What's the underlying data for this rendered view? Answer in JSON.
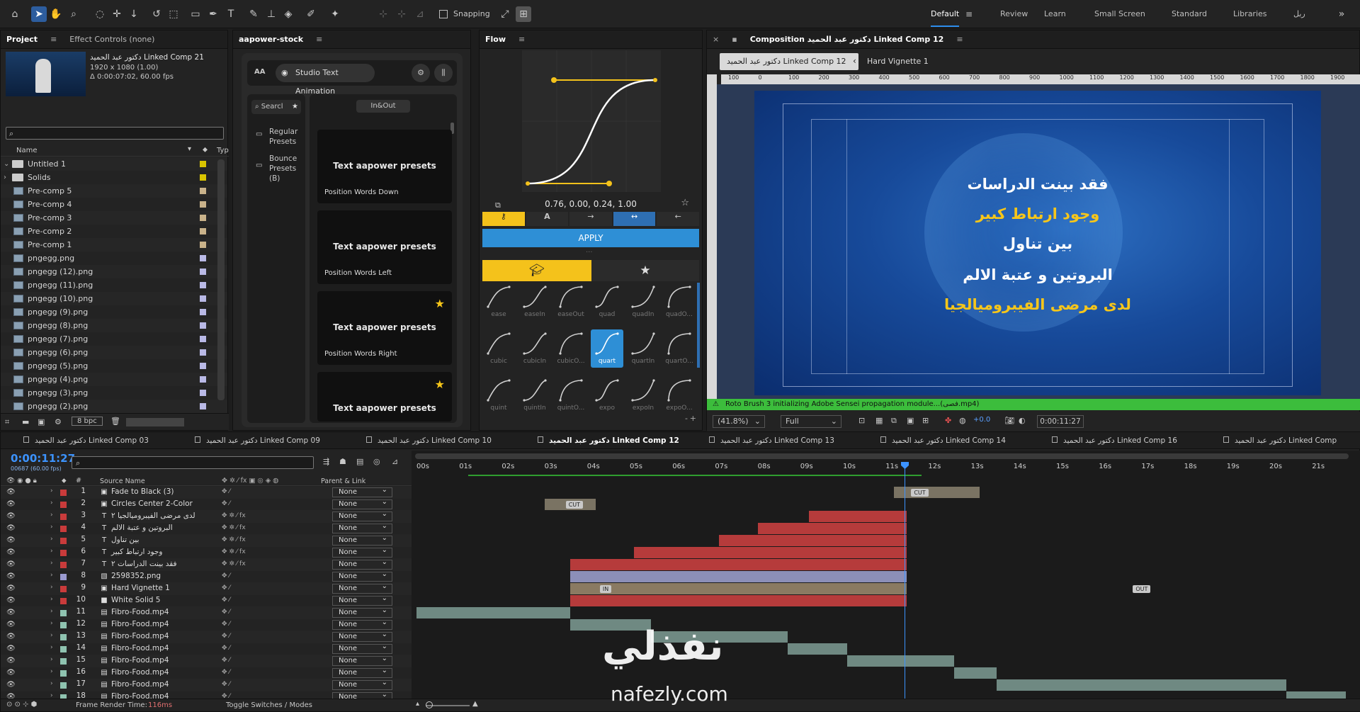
{
  "toolbar": {
    "snapping_label": "Snapping",
    "workspaces": [
      "Default",
      "Review",
      "Learn",
      "Small Screen",
      "Standard",
      "Libraries",
      "ربل"
    ],
    "active_workspace": "Default"
  },
  "project": {
    "tabs": [
      "Project",
      "Effect Controls (none)"
    ],
    "item_name": "دكتور عبد الحميد  Linked Comp 21",
    "item_res": "1920 x 1080 (1.00)",
    "item_dur": "Δ 0:00:07:02, 60.00 fps",
    "search_placeholder": "",
    "col_name": "Name",
    "col_type": "Typ",
    "items": [
      "Untitled 1",
      "Solids",
      "Pre-comp 5",
      "Pre-comp 4",
      "Pre-comp 3",
      "Pre-comp 2",
      "Pre-comp 1",
      "pngegg.png",
      "pngegg (12).png",
      "pngegg (11).png",
      "pngegg (10).png",
      "pngegg (9).png",
      "pngegg (8).png",
      "pngegg (7).png",
      "pngegg (6).png",
      "pngegg (5).png",
      "pngegg (4).png",
      "pngegg (3).png",
      "pngegg (2).png"
    ],
    "bpc": "8 bpc"
  },
  "aapower": {
    "panel_title": "aapower-stock",
    "aa": "AA",
    "studio_label": "Studio Text Animation",
    "search_label": "Searcl",
    "inout_label": "In&Out",
    "categories": [
      "Regular Presets",
      "Bounce Presets (B)"
    ],
    "presets": [
      {
        "title": "Text aapower presets",
        "sub": "Position Words Down",
        "star": false
      },
      {
        "title": "Text aapower presets",
        "sub": "Position Words Left",
        "star": false
      },
      {
        "title": "Text aapower presets",
        "sub": "Position Words Right",
        "star": true
      },
      {
        "title": "Text aapower presets",
        "sub": "",
        "star": true
      }
    ]
  },
  "flow": {
    "panel_title": "Flow",
    "bezier_values": "0.76, 0.00, 0.24, 1.00",
    "apply_label": "APPLY",
    "ease_names": [
      "ease",
      "easeIn",
      "easeOut",
      "quad",
      "quadIn",
      "quadO...",
      "cubic",
      "cubicIn",
      "cubicO...",
      "quart",
      "quartIn",
      "quartO...",
      "quint",
      "quintIn",
      "quintO...",
      "expo",
      "expoIn",
      "expoO..."
    ],
    "selected_ease": "quart",
    "accent": "#f4c21b",
    "blue": "#2e8fd6"
  },
  "composition": {
    "panel_title": "Composition دكتور عبد الحميد  Linked Comp 12",
    "active_tab": "دكتور عبد الحميد  Linked Comp 12",
    "other_tab": "Hard Vignette 1",
    "ruler_labels": [
      "100",
      "0",
      "100",
      "200",
      "300",
      "400",
      "500",
      "600",
      "700",
      "800",
      "900",
      "1000",
      "1100",
      "1200",
      "1300",
      "1400",
      "1500",
      "1600",
      "1700",
      "1800",
      "1900",
      "200"
    ],
    "captions": [
      {
        "text": "فقد بينت الدراسات",
        "color": "#ffffff"
      },
      {
        "text": "وجود ارتباط كبير",
        "color": "#f6c61a"
      },
      {
        "text": "بين تناول",
        "color": "#ffffff"
      },
      {
        "text": "البروتين و عتبة الالم",
        "color": "#ffffff"
      },
      {
        "text": "لدى مرضى الفيبروميالجيا",
        "color": "#f6c61a"
      }
    ],
    "warning": "Roto Brush 3 initializing Adobe Sensei propagation module...(فصى.mp4)",
    "zoom": "(41.8%)",
    "resolution": "Full",
    "exposure": "+0.0",
    "timecode": "0:00:11:27"
  },
  "timeline": {
    "tabs": [
      "دكتور عبد الحميد  Linked Comp 03",
      "دكتور عبد الحميد  Linked Comp 09",
      "دكتور عبد الحميد  Linked Comp 10",
      "دكتور عبد الحميد  Linked Comp 12",
      "دكتور عبد الحميد  Linked Comp 13",
      "دكتور عبد الحميد  Linked Comp 14",
      "دكتور عبد الحميد  Linked Comp 16",
      "دكتور عبد الحميد  Linked Comp"
    ],
    "active_tab": "دكتور عبد الحميد  Linked Comp 12",
    "current_time": "0:00:11:27",
    "frame_info": "00687 (60.00 fps)",
    "col_source": "Source Name",
    "col_parent": "Parent & Link",
    "ruler": [
      "00s",
      "01s",
      "02s",
      "03s",
      "04s",
      "05s",
      "06s",
      "07s",
      "08s",
      "09s",
      "10s",
      "11s",
      "12s",
      "13s",
      "14s",
      "15s",
      "16s",
      "17s",
      "18s",
      "19s",
      "20s",
      "21s"
    ],
    "parent_value": "None",
    "layers": [
      {
        "n": "1",
        "name": "Fade to Black (3)",
        "type": "comp",
        "color": "#c93b3b"
      },
      {
        "n": "2",
        "name": "Circles Center 2-Color",
        "type": "comp",
        "color": "#c93b3b"
      },
      {
        "n": "3",
        "name": "لدى مرضى الفيبروميالجيا ٢",
        "type": "text",
        "color": "#c93b3b"
      },
      {
        "n": "4",
        "name": "البروتين و عتبة الالم",
        "type": "text",
        "color": "#c93b3b"
      },
      {
        "n": "5",
        "name": "بين تناول",
        "type": "text",
        "color": "#c93b3b"
      },
      {
        "n": "6",
        "name": "وجود ارتباط كبير",
        "type": "text",
        "color": "#c93b3b"
      },
      {
        "n": "7",
        "name": "فقد بينت الدراسات ٢",
        "type": "text",
        "color": "#c93b3b"
      },
      {
        "n": "8",
        "name": "2598352.png",
        "type": "image",
        "color": "#9b9bd0"
      },
      {
        "n": "9",
        "name": "Hard Vignette 1",
        "type": "comp",
        "color": "#c93b3b"
      },
      {
        "n": "10",
        "name": "White Solid 5",
        "type": "solid",
        "color": "#c93b3b"
      },
      {
        "n": "11",
        "name": "Fibro-Food.mp4",
        "type": "video",
        "color": "#8fc3b0"
      },
      {
        "n": "12",
        "name": "Fibro-Food.mp4",
        "type": "video",
        "color": "#8fc3b0"
      },
      {
        "n": "13",
        "name": "Fibro-Food.mp4",
        "type": "video",
        "color": "#8fc3b0"
      },
      {
        "n": "14",
        "name": "Fibro-Food.mp4",
        "type": "video",
        "color": "#8fc3b0"
      },
      {
        "n": "15",
        "name": "Fibro-Food.mp4",
        "type": "video",
        "color": "#8fc3b0"
      },
      {
        "n": "16",
        "name": "Fibro-Food.mp4",
        "type": "video",
        "color": "#8fc3b0"
      },
      {
        "n": "17",
        "name": "Fibro-Food.mp4",
        "type": "video",
        "color": "#8fc3b0"
      },
      {
        "n": "18",
        "name": "Fibro-Food.mp4",
        "type": "video",
        "color": "#8fc3b0"
      }
    ],
    "bar_labels": {
      "cut": "CUT",
      "in": "IN",
      "out": "OUT"
    },
    "render_time_label": "Frame Render Time:",
    "render_time_value": "116ms",
    "toggle_label": "Toggle Switches / Modes"
  },
  "watermark": {
    "arabic": "نفذلي",
    "latin": "nafezly.com"
  }
}
